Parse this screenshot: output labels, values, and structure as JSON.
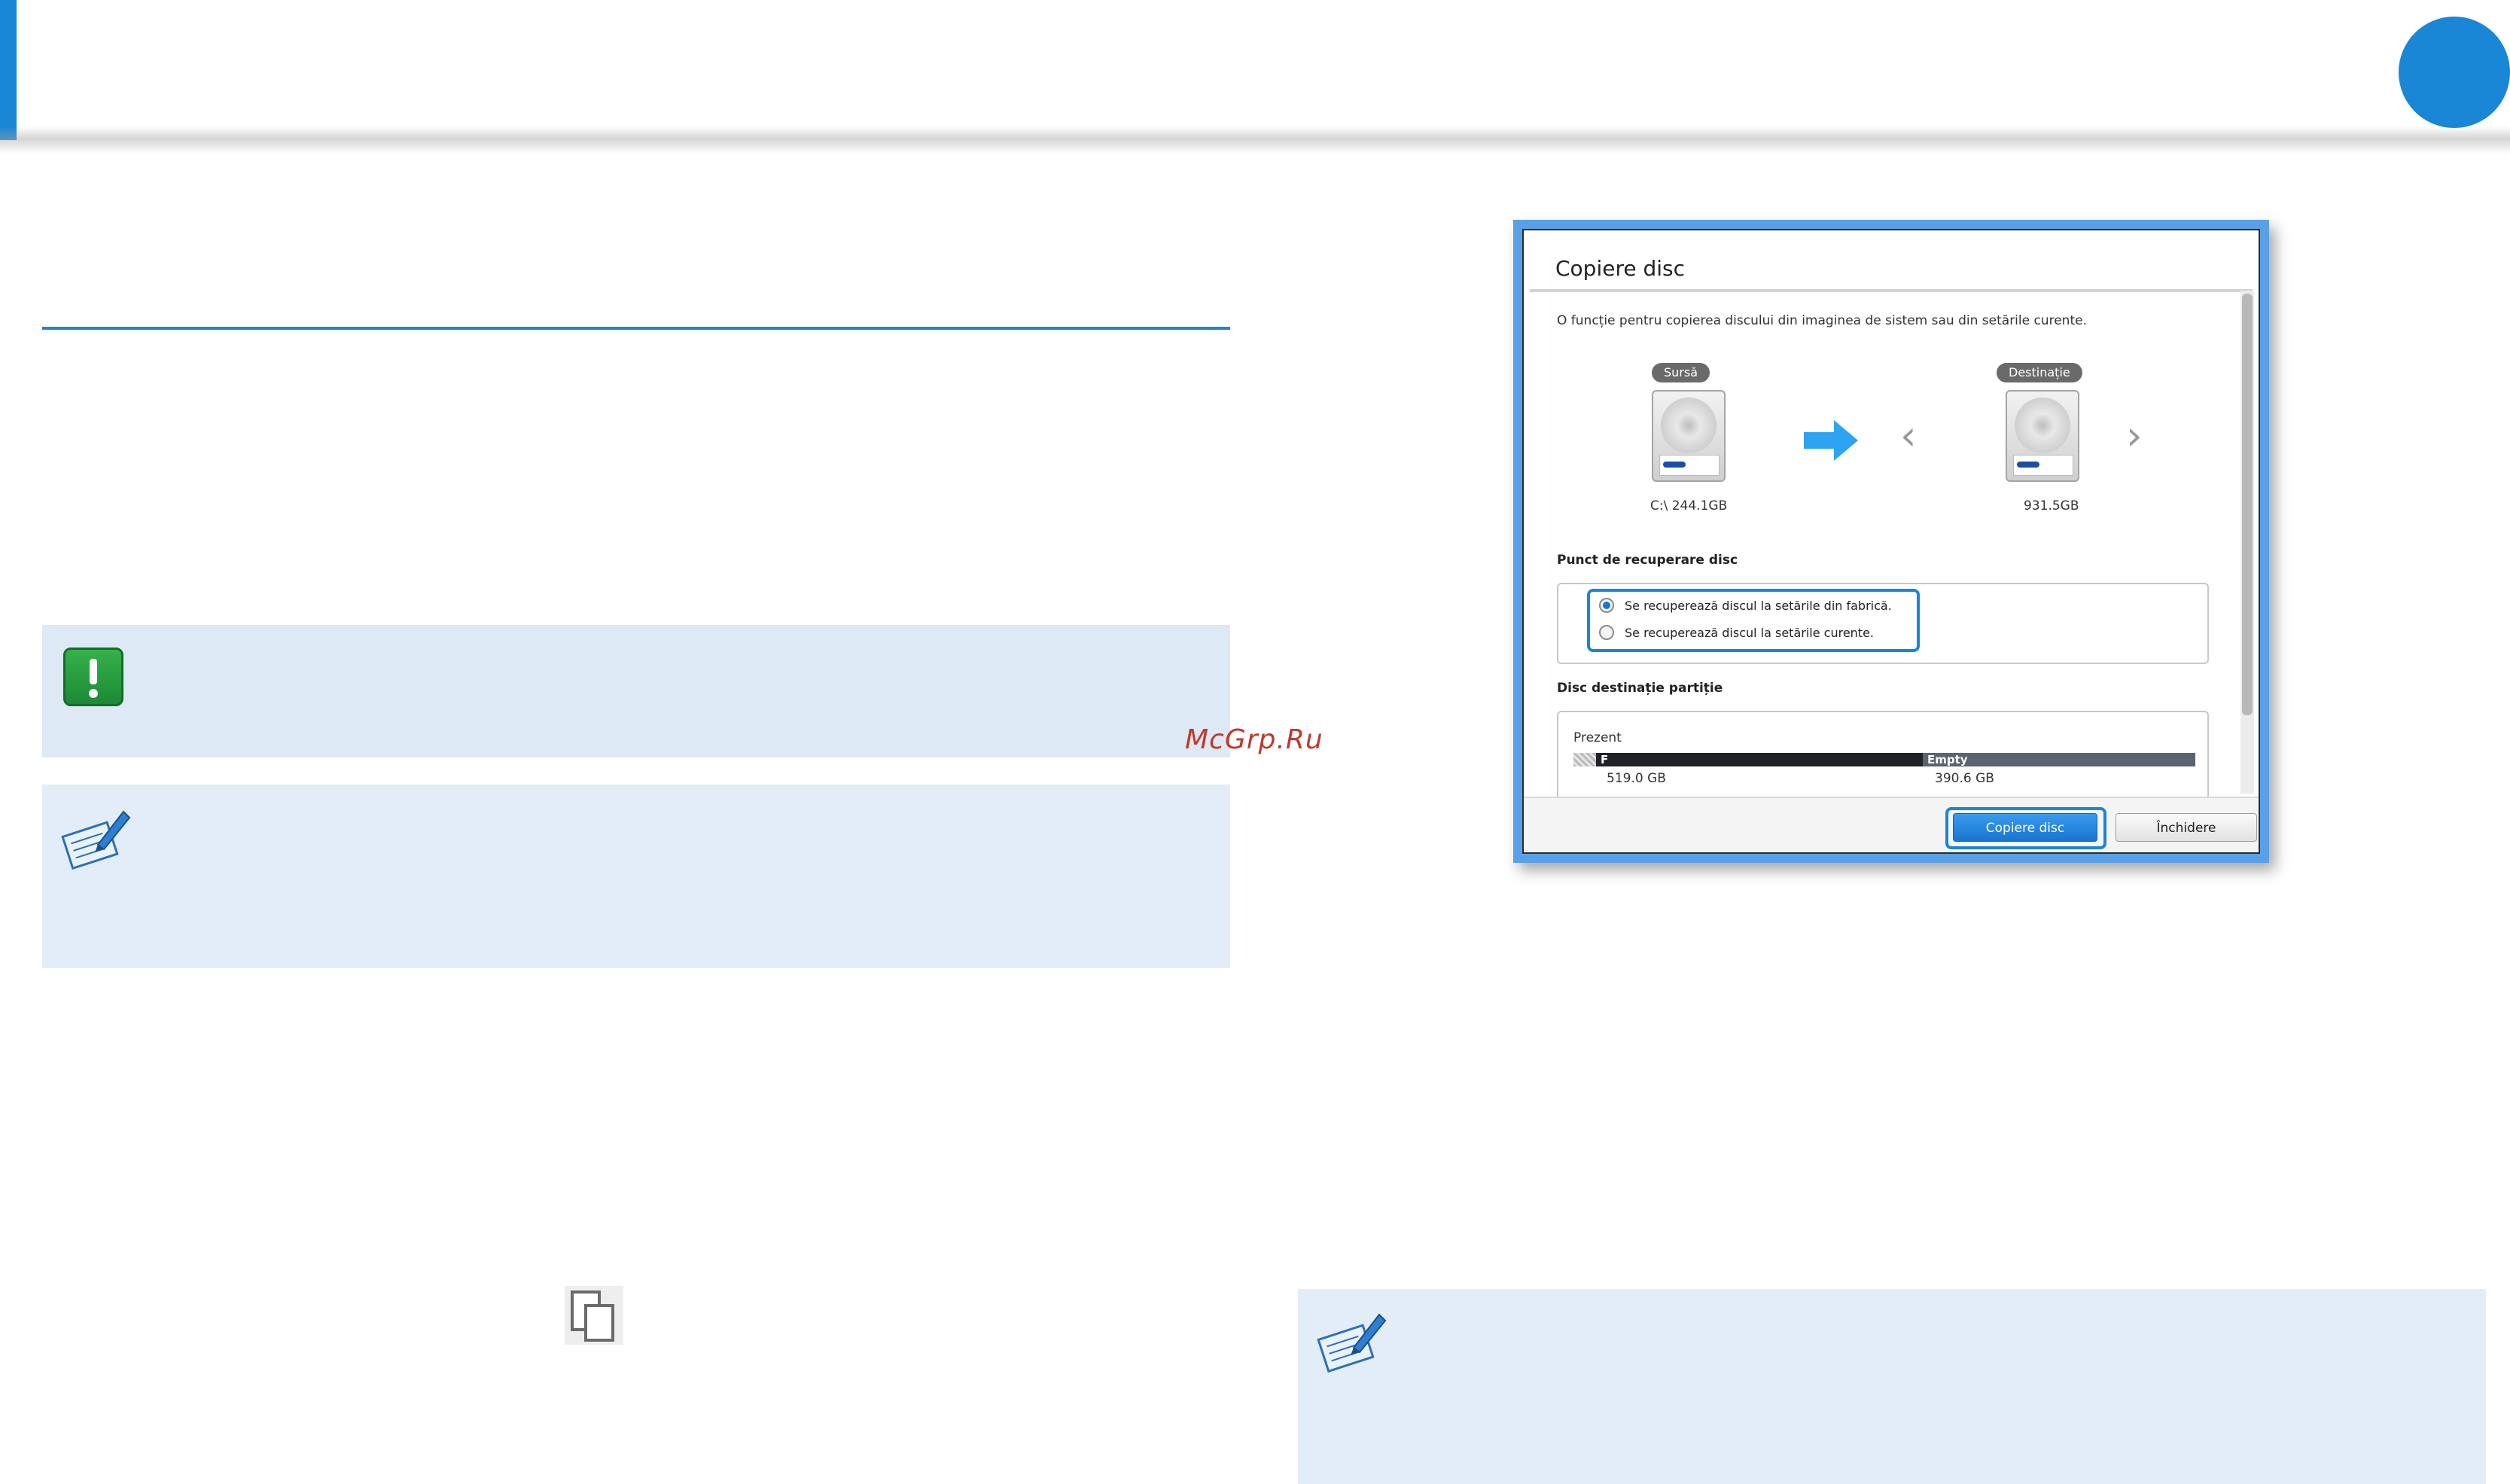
{
  "page": {
    "watermark": "McGrp.Ru",
    "accent_color": "#1a86d6"
  },
  "icons": {
    "warning": "exclamation-icon",
    "note": "note-pen-icon",
    "copy": "copy-icon"
  },
  "dialog": {
    "title": "Copiere disc",
    "description": "O funcție pentru copierea discului din imaginea de sistem sau din setările curente.",
    "source": {
      "badge": "Sursă",
      "caption": "C:\\ 244.1GB"
    },
    "destination": {
      "badge": "Destinație",
      "caption": "931.5GB"
    },
    "recovery_point": {
      "label": "Punct de recuperare disc",
      "options": [
        {
          "label": "Se recuperează discul la setările din fabrică.",
          "selected": true
        },
        {
          "label": "Se recuperează discul la setările curente.",
          "selected": false
        }
      ]
    },
    "partition": {
      "label": "Disc destinație partiție",
      "current_label": "Prezent",
      "segments": [
        {
          "name": "F",
          "size": "519.0 GB",
          "color": "#1f2328"
        },
        {
          "name": "Empty",
          "size": "390.6 GB",
          "color": "#5a6470"
        }
      ]
    },
    "buttons": {
      "primary": "Copiere disc",
      "secondary": "Închidere"
    }
  }
}
